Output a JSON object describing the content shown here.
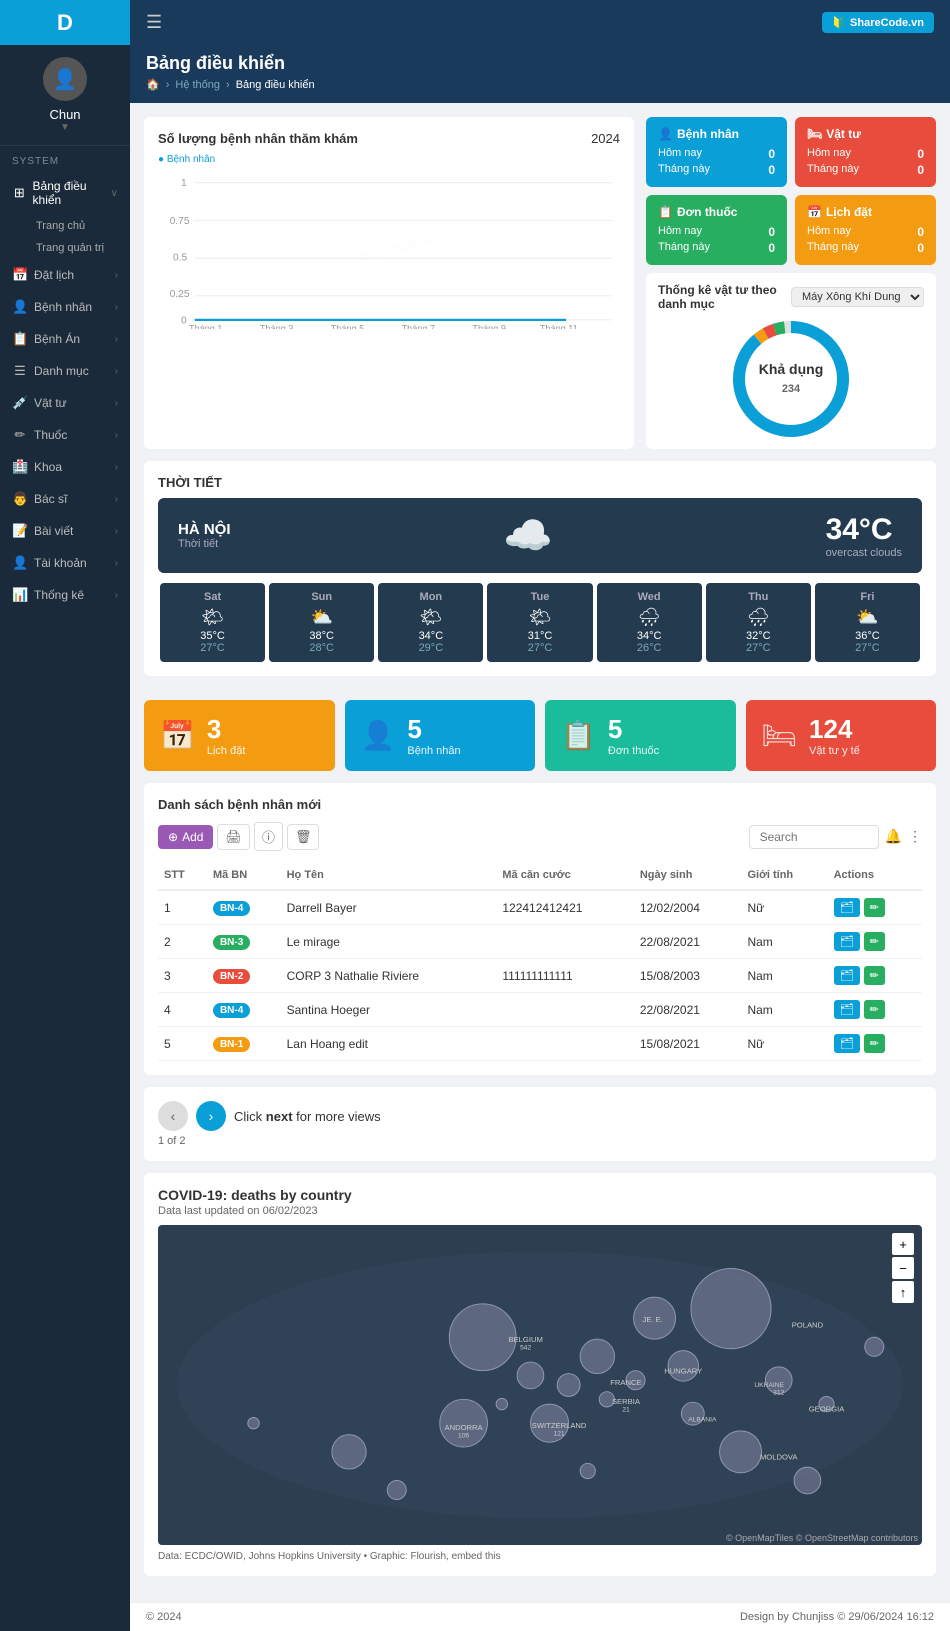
{
  "app": {
    "logo": "D",
    "brand": "ShareCode.vn"
  },
  "topbar": {
    "menu_icon": "☰",
    "logo_text": "SHARECODE.VN"
  },
  "page": {
    "title": "Bảng điều khiển",
    "breadcrumb_home": "🏠",
    "breadcrumb_system": "Hệ thống",
    "breadcrumb_active": "Bảng điều khiển"
  },
  "sidebar": {
    "username": "Chun",
    "section_label": "SYSTEM",
    "items": [
      {
        "label": "Bảng điều khiển",
        "icon": "⊞",
        "has_sub": true,
        "active": true
      },
      {
        "label": "Trang chủ",
        "icon": "",
        "sub": true
      },
      {
        "label": "Trang quản trị",
        "icon": "",
        "sub": true
      },
      {
        "label": "Đặt lịch",
        "icon": "📅",
        "has_sub": true
      },
      {
        "label": "Bệnh nhân",
        "icon": "👤",
        "has_sub": true
      },
      {
        "label": "Bệnh Án",
        "icon": "📋",
        "has_sub": true
      },
      {
        "label": "Danh mục",
        "icon": "☰",
        "has_sub": true
      },
      {
        "label": "Vật tư",
        "icon": "💉",
        "has_sub": true
      },
      {
        "label": "Thuốc",
        "icon": "✏",
        "has_sub": true
      },
      {
        "label": "Khoa",
        "icon": "🏥",
        "has_sub": true
      },
      {
        "label": "Bác sĩ",
        "icon": "👨‍⚕",
        "has_sub": true
      },
      {
        "label": "Bài viết",
        "icon": "📝",
        "has_sub": true
      },
      {
        "label": "Tài khoản",
        "icon": "👤",
        "has_sub": true
      },
      {
        "label": "Thống kê",
        "icon": "📊",
        "has_sub": true
      }
    ]
  },
  "chart": {
    "title": "Số lượng bệnh nhân thăm khám",
    "year": "2024",
    "legend": "Bệnh nhân",
    "x_labels": [
      "Tháng 1",
      "Tháng 3",
      "Tháng 5",
      "Tháng 7",
      "Tháng 9",
      "Tháng 11"
    ],
    "y_labels": [
      "0",
      "0.25",
      "0.5",
      "0.75",
      "1"
    ]
  },
  "stat_cards": {
    "patient": {
      "title": "Bệnh nhân",
      "icon": "👤",
      "today_label": "Hôm nay",
      "today_value": "0",
      "month_label": "Tháng này",
      "month_value": "0",
      "color": "blue"
    },
    "supply": {
      "title": "Vật tư",
      "icon": "💊",
      "today_label": "Hôm nay",
      "today_value": "0",
      "month_label": "Tháng này",
      "month_value": "0",
      "color": "red"
    },
    "prescription": {
      "title": "Đơn thuốc",
      "icon": "📋",
      "today_label": "Hôm nay",
      "today_value": "0",
      "month_label": "Tháng này",
      "month_value": "0",
      "color": "green"
    },
    "appointment": {
      "title": "Lịch đặt",
      "icon": "📅",
      "today_label": "Hôm nay",
      "today_value": "0",
      "month_label": "Tháng này",
      "month_value": "0",
      "color": "orange"
    }
  },
  "donut": {
    "title": "Thống kê vật tư theo danh mục",
    "select_label": "Máy Xông Khí Dung",
    "center_label": "Khả dụng",
    "center_value": "234"
  },
  "weather": {
    "section_title": "THỜI TIẾT",
    "city": "HÀ NỘI",
    "city_sub": "Thời tiết",
    "temp": "34°C",
    "temp_desc": "overcast clouds",
    "days": [
      {
        "name": "Sat",
        "icon": "🌤",
        "high": "35°C",
        "low": "27°C"
      },
      {
        "name": "Sun",
        "icon": "⛅",
        "high": "38°C",
        "low": "28°C"
      },
      {
        "name": "Mon",
        "icon": "🌤",
        "high": "34°C",
        "low": "29°C"
      },
      {
        "name": "Tue",
        "icon": "🌤",
        "high": "31°C",
        "low": "27°C"
      },
      {
        "name": "Wed",
        "icon": "🌧",
        "high": "34°C",
        "low": "26°C"
      },
      {
        "name": "Thu",
        "icon": "🌧",
        "high": "32°C",
        "low": "27°C"
      },
      {
        "name": "Fri",
        "icon": "⛅",
        "high": "36°C",
        "low": "27°C"
      }
    ]
  },
  "bottom_cards": [
    {
      "icon": "📅",
      "number": "3",
      "label": "Lịch đặt",
      "color": "orange"
    },
    {
      "icon": "👤",
      "number": "5",
      "label": "Bệnh nhân",
      "color": "blue"
    },
    {
      "icon": "📋",
      "number": "5",
      "label": "Đơn thuốc",
      "color": "teal"
    },
    {
      "icon": "🛏",
      "number": "124",
      "label": "Vật tư y tế",
      "color": "red"
    }
  ],
  "patient_table": {
    "title": "Danh sách bệnh nhân mới",
    "add_btn": "Add",
    "search_placeholder": "Search",
    "columns": [
      "STT",
      "Mã BN",
      "Họ Tên",
      "Mã căn cước",
      "Ngày sinh",
      "Giới tính",
      "Actions"
    ],
    "rows": [
      {
        "stt": "1",
        "ma_bn": "BN-4",
        "badge_class": "badge-bn4",
        "ho_ten": "Darrell Bayer",
        "ma_can_cuoc": "122412412421",
        "ngay_sinh": "12/02/2004",
        "gioi_tinh": "Nữ"
      },
      {
        "stt": "2",
        "ma_bn": "BN-3",
        "badge_class": "badge-bn3",
        "ho_ten": "Le mirage",
        "ma_can_cuoc": "",
        "ngay_sinh": "22/08/2021",
        "gioi_tinh": "Nam"
      },
      {
        "stt": "3",
        "ma_bn": "BN-2",
        "badge_class": "badge-bn2",
        "ho_ten": "CORP 3 Nathalie Riviere",
        "ma_can_cuoc": "111111111111",
        "ngay_sinh": "15/08/2003",
        "gioi_tinh": "Nam"
      },
      {
        "stt": "4",
        "ma_bn": "BN-4",
        "badge_class": "badge-bn4",
        "ho_ten": "Santina Hoeger",
        "ma_can_cuoc": "",
        "ngay_sinh": "22/08/2021",
        "gioi_tinh": "Nam"
      },
      {
        "stt": "5",
        "ma_bn": "BN-1",
        "badge_class": "badge-bn1",
        "ho_ten": "Lan Hoang edit",
        "ma_can_cuoc": "",
        "ngay_sinh": "15/08/2021",
        "gioi_tinh": "Nữ"
      }
    ]
  },
  "next_section": {
    "click_text": "Click",
    "next_label": "next",
    "for_more": "for more views",
    "page_info": "1 of 2"
  },
  "covid_map": {
    "title": "COVID-19: deaths by country",
    "subtitle": "Data last updated on 06/02/2023",
    "attr": "© OpenMapTiles © OpenStreetMap contributors",
    "source": "Data: ECDC/OWID, Johns Hopkins University • Graphic: Flourish, embed this"
  },
  "footer": {
    "copyright": "© 2024",
    "design": "Design by Chunjiss © 29/06/2024 16:12"
  }
}
